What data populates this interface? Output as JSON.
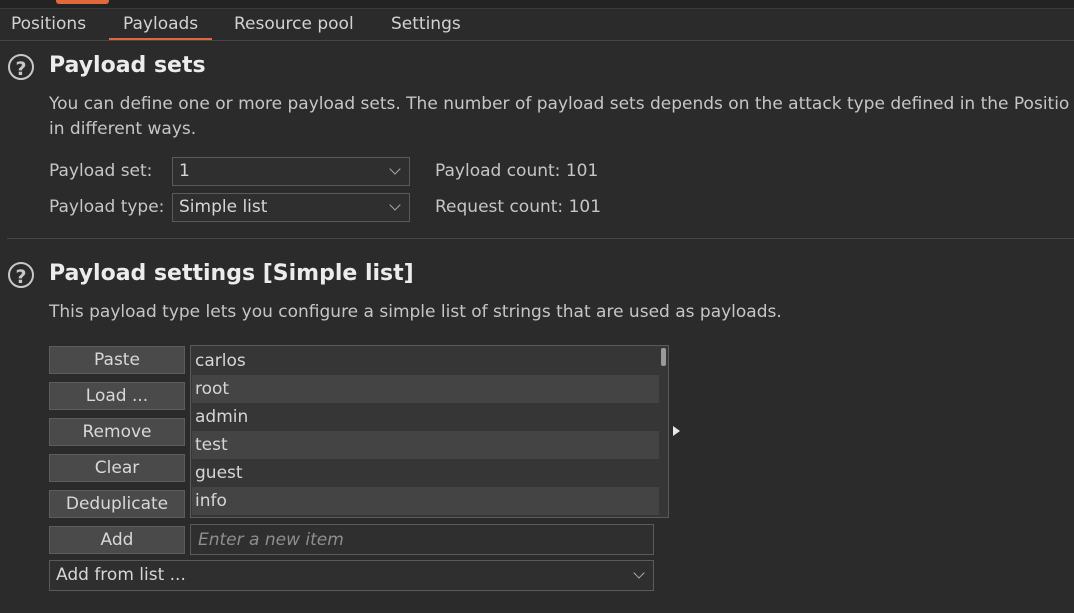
{
  "tabs": [
    {
      "label": "Positions"
    },
    {
      "label": "Payloads"
    },
    {
      "label": "Resource pool"
    },
    {
      "label": "Settings"
    }
  ],
  "active_tab": "Payloads",
  "help_glyph": "?",
  "payload_sets": {
    "title": "Payload sets",
    "description_line1": "You can define one or more payload sets. The number of payload sets depends on the attack type defined in the Positio",
    "description_line2": "in different ways.",
    "set_label": "Payload set:",
    "set_value": "1",
    "count_label": "Payload count:",
    "count_value": "101",
    "type_label": "Payload type:",
    "type_value": "Simple list",
    "request_label": "Request count:",
    "request_value": "101"
  },
  "payload_settings": {
    "title": "Payload settings [Simple list]",
    "description": "This payload type lets you configure a simple list of strings that are used as payloads.",
    "buttons": {
      "paste": "Paste",
      "load": "Load ...",
      "remove": "Remove",
      "clear": "Clear",
      "deduplicate": "Deduplicate",
      "add": "Add"
    },
    "items": [
      "carlos",
      "root",
      "admin",
      "test",
      "guest",
      "info"
    ],
    "add_placeholder": "Enter a new item",
    "add_from_list": "Add from list ..."
  },
  "colors": {
    "accent": "#e0683a",
    "background": "#2b2b2b"
  }
}
